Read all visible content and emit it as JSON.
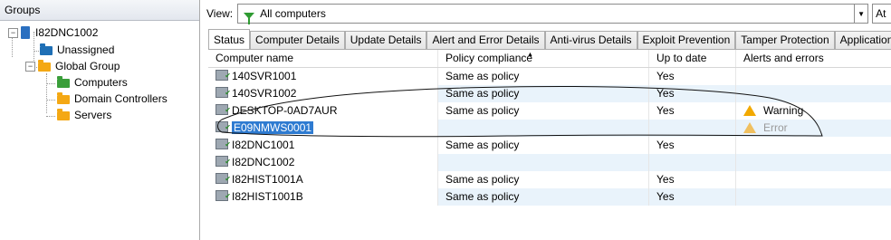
{
  "groups": {
    "header": "Groups",
    "root": "I82DNC1002",
    "items": [
      "Unassigned",
      "Global Group",
      "Computers",
      "Domain Controllers",
      "Servers"
    ]
  },
  "view": {
    "label": "View:",
    "value": "All computers",
    "extra": "At"
  },
  "tabs": [
    "Status",
    "Computer Details",
    "Update Details",
    "Alert and Error Details",
    "Anti-virus Details",
    "Exploit Prevention",
    "Tamper Protection",
    "Application"
  ],
  "columns": [
    "Computer name",
    "Policy compliance",
    "Up to date",
    "Alerts and errors"
  ],
  "rows": [
    {
      "name": "140SVR1001",
      "policy": "Same as policy",
      "uptodate": "Yes",
      "alert": ""
    },
    {
      "name": "140SVR1002",
      "policy": "Same as policy",
      "uptodate": "Yes",
      "alert": ""
    },
    {
      "name": "DESKTOP-0AD7AUR",
      "policy": "Same as policy",
      "uptodate": "Yes",
      "alert": "Warning"
    },
    {
      "name": "E09NMWS0001",
      "policy": "",
      "uptodate": "",
      "alert": "Error"
    },
    {
      "name": "I82DNC1001",
      "policy": "Same as policy",
      "uptodate": "Yes",
      "alert": ""
    },
    {
      "name": "I82DNC1002",
      "policy": "",
      "uptodate": "",
      "alert": ""
    },
    {
      "name": "I82HIST1001A",
      "policy": "Same as policy",
      "uptodate": "Yes",
      "alert": ""
    },
    {
      "name": "I82HIST1001B",
      "policy": "Same as policy",
      "uptodate": "Yes",
      "alert": ""
    }
  ]
}
